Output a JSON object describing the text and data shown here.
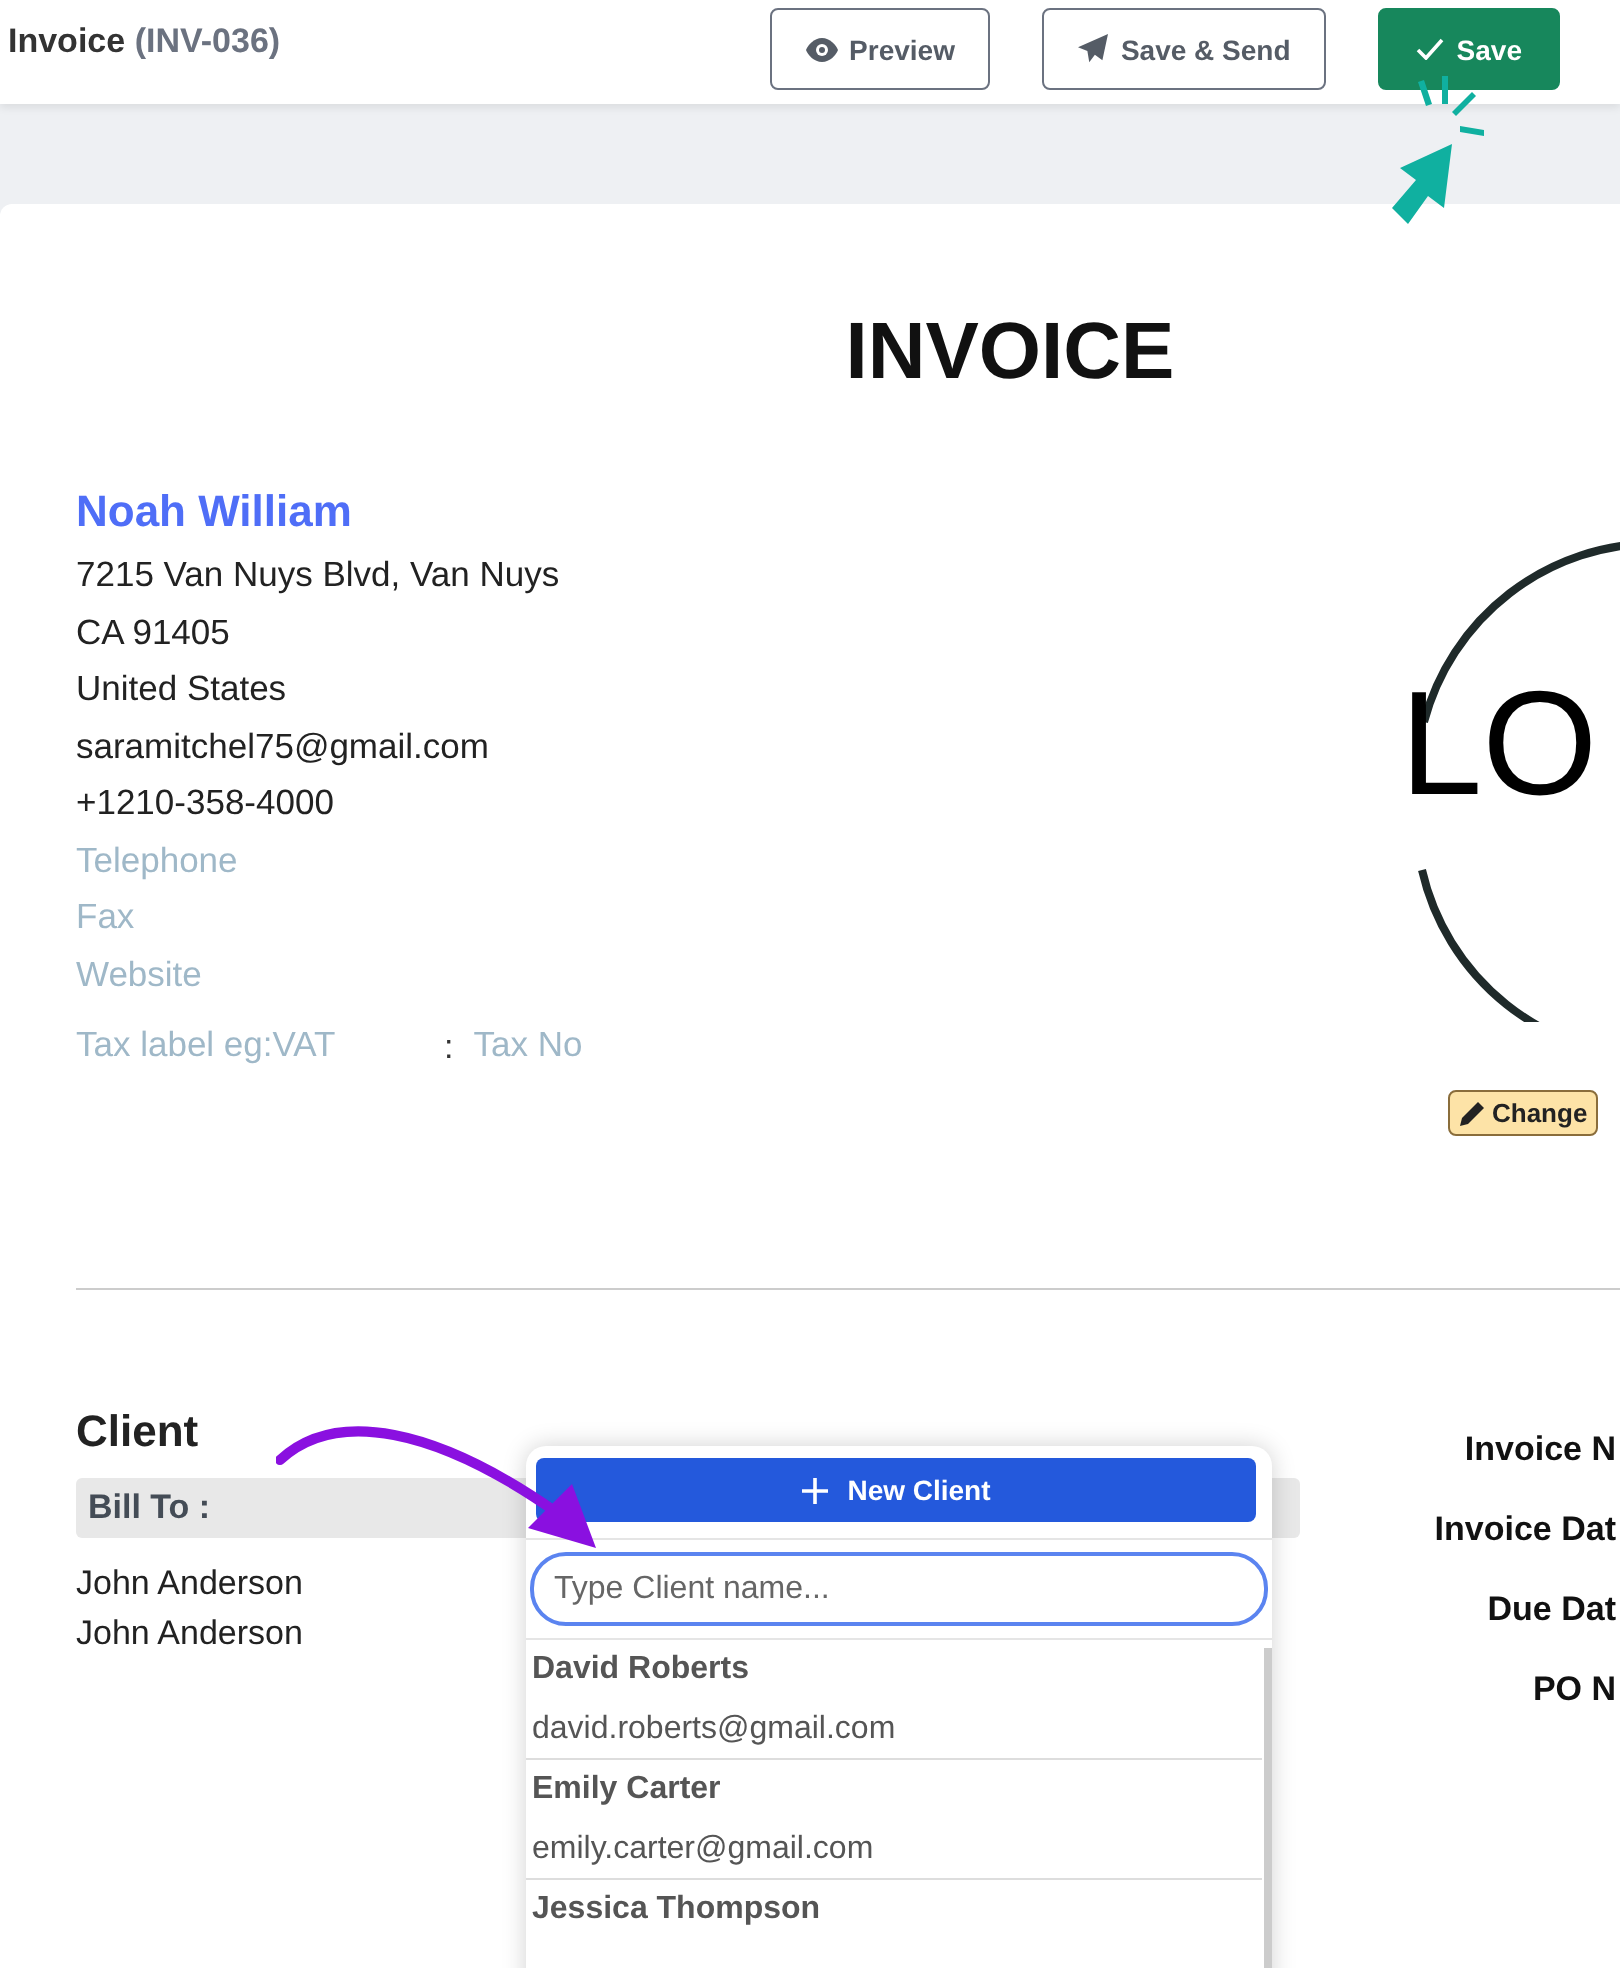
{
  "header": {
    "title": "Invoice",
    "number": "(INV-036)",
    "buttons": [
      {
        "label": "Preview",
        "kind": "preview"
      },
      {
        "label": "Save & Send",
        "kind": "send"
      },
      {
        "label": "Save",
        "kind": "save"
      }
    ]
  },
  "document": {
    "heading": "INVOICE",
    "business": {
      "name": "Noah William",
      "lines": [
        "7215 Van Nuys Blvd, Van Nuys",
        "CA 91405",
        "United States",
        "saramitchel75@gmail.com",
        "+1210-358-4000"
      ],
      "fields": [
        {
          "placeholder": "Telephone"
        },
        {
          "placeholder": "Fax"
        },
        {
          "placeholder": "Website"
        }
      ],
      "tax_label": {
        "placeholder": "Tax label eg:VAT"
      },
      "tax_separator": ":",
      "tax_number": {
        "placeholder": "Tax No"
      }
    },
    "logo": {
      "text": "LO",
      "change_button": "Change"
    },
    "client": {
      "heading": "Client",
      "bill_to": "Bill To :",
      "lines": [
        "John Anderson",
        "John Anderson"
      ]
    },
    "meta_labels": [
      "Invoice N",
      "Invoice Dat",
      "Due Dat",
      "PO N"
    ]
  },
  "client_dropdown": {
    "new_button": "New Client",
    "search": {
      "placeholder": "Type Client name..."
    },
    "clients": [
      {
        "name": "David Roberts",
        "email": "david.roberts@gmail.com"
      },
      {
        "name": "Emily Carter",
        "email": "emily.carter@gmail.com"
      },
      {
        "name": "Jessica Thompson"
      }
    ]
  }
}
